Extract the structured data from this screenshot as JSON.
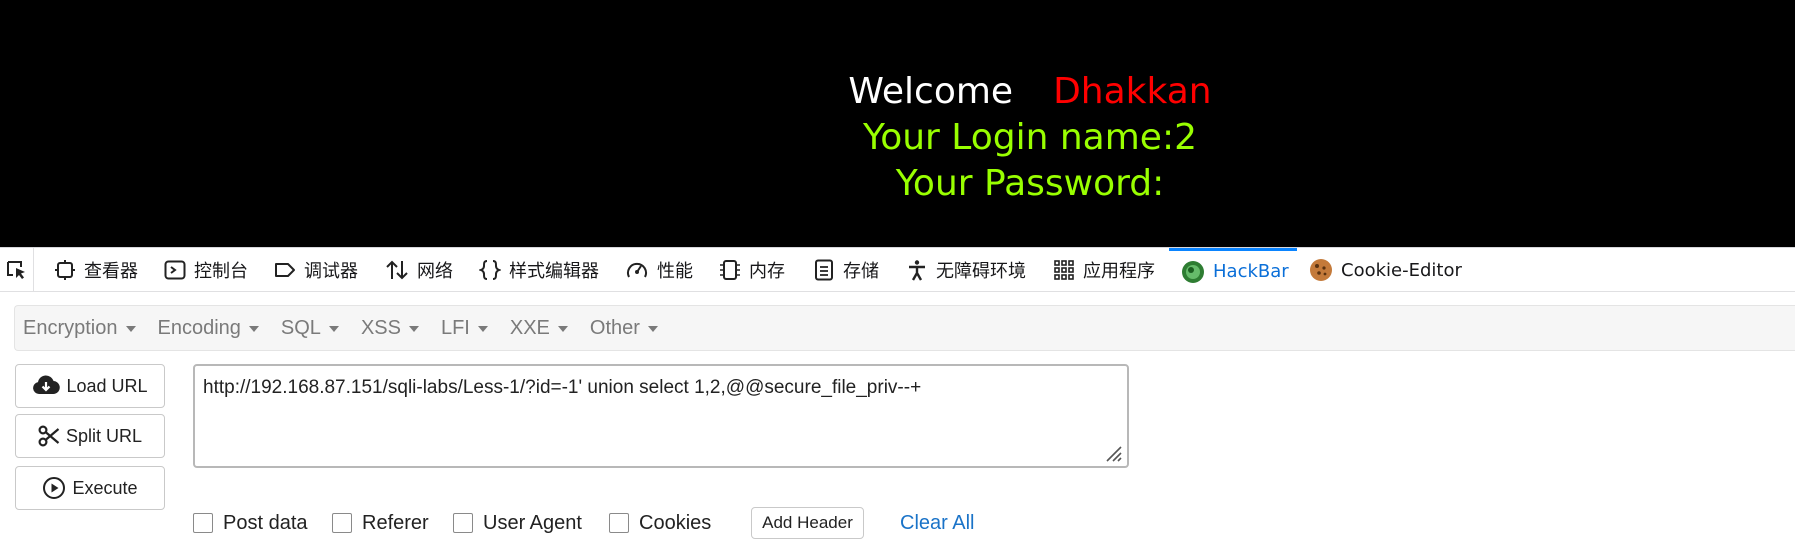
{
  "page": {
    "welcome": "Welcome",
    "user_name": "Dhakkan",
    "login_line": "Your Login name:2",
    "password_line": "Your Password:"
  },
  "devtools": {
    "tabs": [
      {
        "label": "查看器",
        "icon": "inspector-icon"
      },
      {
        "label": "控制台",
        "icon": "console-icon"
      },
      {
        "label": "调试器",
        "icon": "debugger-icon"
      },
      {
        "label": "网络",
        "icon": "network-icon"
      },
      {
        "label": "样式编辑器",
        "icon": "style-editor-icon"
      },
      {
        "label": "性能",
        "icon": "performance-icon"
      },
      {
        "label": "内存",
        "icon": "memory-icon"
      },
      {
        "label": "存储",
        "icon": "storage-icon"
      },
      {
        "label": "无障碍环境",
        "icon": "accessibility-icon"
      },
      {
        "label": "应用程序",
        "icon": "application-icon"
      },
      {
        "label": "HackBar",
        "icon": "hackbar-icon",
        "active": true
      },
      {
        "label": "Cookie-Editor",
        "icon": "cookie-icon"
      }
    ],
    "active_color": "#0a84ff"
  },
  "hackbar": {
    "menus": [
      "Encryption",
      "Encoding",
      "SQL",
      "XSS",
      "LFI",
      "XXE",
      "Other"
    ],
    "load_url": "Load URL",
    "split_url": "Split URL",
    "execute": "Execute",
    "url_value": "http://192.168.87.151/sqli-labs/Less-1/?id=-1' union select 1,2,@@secure_file_priv--+",
    "options": {
      "post_data": "Post data",
      "referer": "Referer",
      "user_agent": "User Agent",
      "cookies": "Cookies"
    },
    "add_header": "Add Header",
    "clear_all": "Clear All"
  },
  "colors": {
    "page_bg": "#000000",
    "welcome": "#ffffff",
    "user_name": "#ff0000",
    "login_text": "#99ff00",
    "link": "#1a73c8"
  }
}
